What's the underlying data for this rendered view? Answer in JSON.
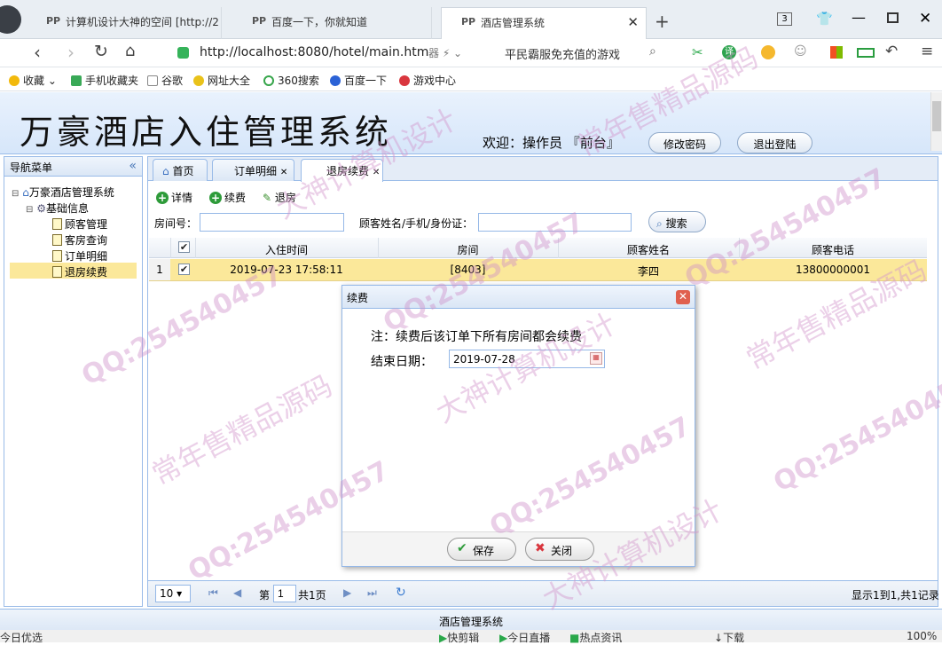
{
  "browser": {
    "tabs": [
      {
        "label": "计算机设计大神的空间 [http://2"
      },
      {
        "label": "百度一下，你就知道"
      },
      {
        "label": "酒店管理系统"
      }
    ],
    "tab_count": "3",
    "url": "http://localhost:8080/hotel/main.htm",
    "search_hint": "平民霸服免充值的游戏",
    "bookmarks": [
      "收藏",
      "手机收藏夹",
      "谷歌",
      "网址大全",
      "360搜索",
      "百度一下",
      "游戏中心"
    ],
    "status_items": [
      "今日优选",
      "快剪辑",
      "今日直播",
      "热点资讯",
      "下载",
      "100%"
    ]
  },
  "app": {
    "title": "万豪酒店入住管理系统",
    "welcome": "欢迎：操作员 『前台』",
    "change_password": "修改密码",
    "logout": "退出登陆",
    "footer": "酒店管理系统"
  },
  "sidebar": {
    "title": "导航菜单",
    "root": "万豪酒店管理系统",
    "group": "基础信息",
    "items": [
      "顾客管理",
      "客房查询",
      "订单明细",
      "退房续费"
    ]
  },
  "tabs": [
    "首页",
    "订单明细",
    "退房续费"
  ],
  "toolbar": {
    "detail": "详情",
    "renew": "续费",
    "checkout": "退房"
  },
  "filters": {
    "room_label": "房间号：",
    "guest_label": "顾客姓名/手机/身份证：",
    "search": "搜索"
  },
  "grid": {
    "columns": [
      "入住时间",
      "房间",
      "顾客姓名",
      "顾客电话"
    ],
    "rows": [
      {
        "index": "1",
        "checkin": "2019-07-23 17:58:11",
        "room": "[8403]",
        "name": "李四",
        "phone": "13800000001"
      }
    ]
  },
  "pager": {
    "page_size": "10",
    "page_prefix": "第",
    "page": "1",
    "page_suffix": "共1页",
    "summary": "显示1到1,共1记录"
  },
  "dialog": {
    "title": "续费",
    "note": "注：续费后该订单下所有房间都会续费",
    "end_label": "结束日期：",
    "end_value": "2019-07-28",
    "save": "保存",
    "close": "关闭"
  },
  "watermarks": [
    "QQ:254540457",
    "大神计算机设计",
    "常年售精品源码"
  ]
}
